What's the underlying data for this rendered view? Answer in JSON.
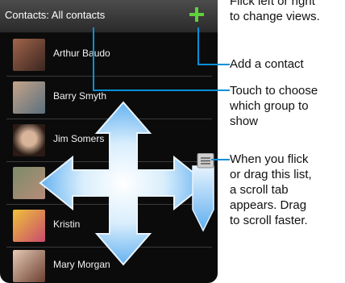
{
  "header": {
    "title": "Contacts: All contacts"
  },
  "contacts": [
    {
      "name": "Arthur Baudo"
    },
    {
      "name": "Barry Smyth"
    },
    {
      "name": "Jim Somers"
    },
    {
      "name": ""
    },
    {
      "name": "Kristin"
    },
    {
      "name": "Mary Morgan"
    }
  ],
  "callouts": {
    "flick": [
      "Flick left or right",
      "to change views."
    ],
    "add": "Add a contact",
    "group": [
      "Touch to choose",
      "which group to",
      "show"
    ],
    "scroll": [
      "When you flick",
      "or drag this list,",
      "a scroll tab",
      "appears. Drag",
      "to scroll faster."
    ]
  },
  "colors": {
    "accent": "#5fd13b",
    "arrow": "#6ab6f2",
    "callout_line": "#0a8fd8"
  }
}
